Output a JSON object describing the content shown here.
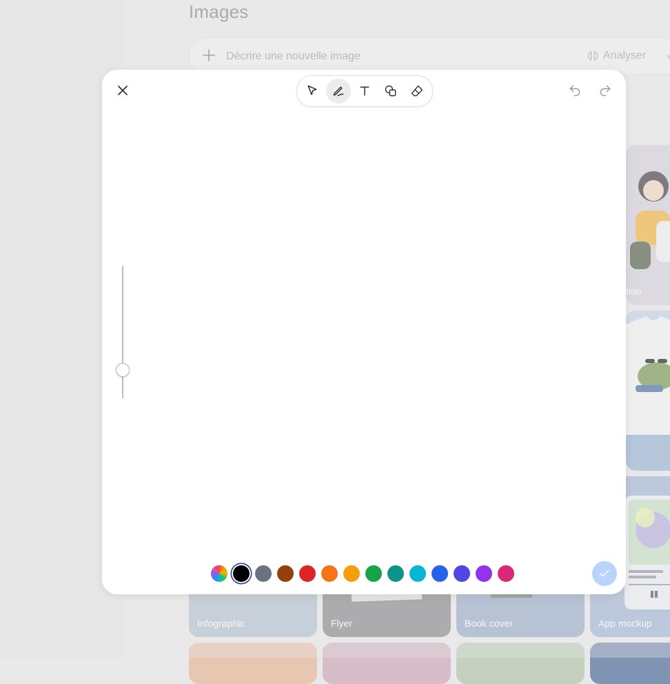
{
  "page": {
    "title": "Images",
    "prompt": {
      "placeholder": "Décrire une nouvelle image",
      "analyse_label": "Analyser"
    },
    "tiles": [
      {
        "label": "Infographic",
        "color": "#b7c4d2"
      },
      {
        "label": "Flyer",
        "color": "#8e8e93"
      },
      {
        "label": "Book cover",
        "color": "#9fb1cc"
      },
      {
        "label": "App mockup",
        "color": "#a6b9d6"
      }
    ],
    "partial_tile_label": "tion"
  },
  "editor": {
    "tools": [
      {
        "name": "select",
        "icon": "pointer-icon"
      },
      {
        "name": "draw",
        "icon": "pen-icon",
        "active": true
      },
      {
        "name": "text",
        "icon": "text-icon"
      },
      {
        "name": "shapes",
        "icon": "shapes-icon"
      },
      {
        "name": "eraser",
        "icon": "eraser-icon"
      }
    ],
    "brush_size_level": 0.22,
    "colors": [
      {
        "name": "rainbow",
        "value": "conic"
      },
      {
        "name": "black",
        "value": "#000000",
        "selected": true
      },
      {
        "name": "gray",
        "value": "#6b7280"
      },
      {
        "name": "brown",
        "value": "#92400e"
      },
      {
        "name": "red",
        "value": "#dc2626"
      },
      {
        "name": "orange",
        "value": "#f97316"
      },
      {
        "name": "amber",
        "value": "#f59e0b"
      },
      {
        "name": "green",
        "value": "#16a34a"
      },
      {
        "name": "teal",
        "value": "#0d9488"
      },
      {
        "name": "cyan",
        "value": "#06b6d4"
      },
      {
        "name": "blue",
        "value": "#2563eb"
      },
      {
        "name": "indigo",
        "value": "#4f46e5"
      },
      {
        "name": "purple",
        "value": "#9333ea"
      },
      {
        "name": "pink",
        "value": "#db2777"
      }
    ],
    "confirm_color": "#b9d4fb"
  }
}
